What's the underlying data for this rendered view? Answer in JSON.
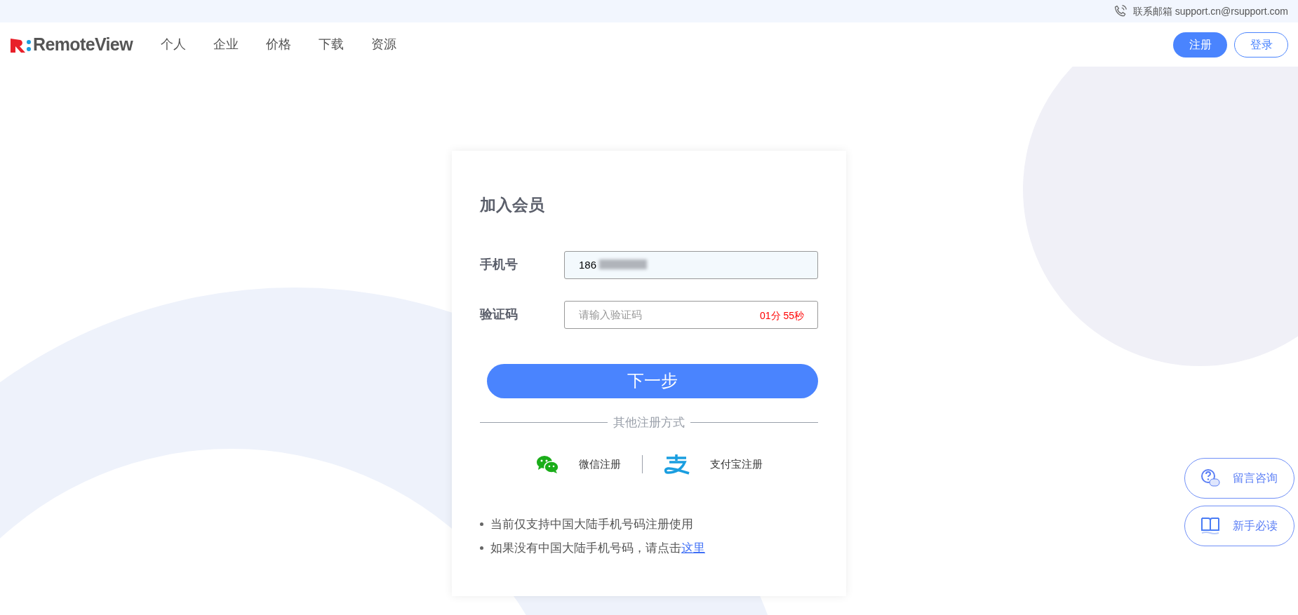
{
  "top_bar": {
    "contact": "联系邮箱 support.cn@rsupport.com"
  },
  "header": {
    "logo_text": "RemoteView",
    "nav": [
      "个人",
      "企业",
      "价格",
      "下载",
      "资源"
    ],
    "buttons": [
      {
        "label": "注册",
        "kind": "primary"
      },
      {
        "label": "登录",
        "kind": "outline"
      }
    ]
  },
  "form": {
    "title": "加入会员",
    "fields": [
      {
        "label": "手机号",
        "value": "186",
        "redacted": true
      },
      {
        "label": "验证码",
        "placeholder": "请输入验证码",
        "timer": "01分 55秒"
      }
    ],
    "submit": "下一步",
    "alt_title": "其他注册方式",
    "social": [
      {
        "label": "微信注册",
        "kind": "wechat"
      },
      {
        "label": "支付宝注册",
        "kind": "alipay"
      }
    ],
    "notes": [
      {
        "text": "当前仅支持中国大陆手机号码注册使用"
      },
      {
        "text": "如果没有中国大陆手机号码，请点击",
        "link": "这里"
      }
    ]
  },
  "floating": [
    {
      "label": "留言咨询",
      "kind": "chat"
    },
    {
      "label": "新手必读",
      "kind": "book"
    }
  ]
}
